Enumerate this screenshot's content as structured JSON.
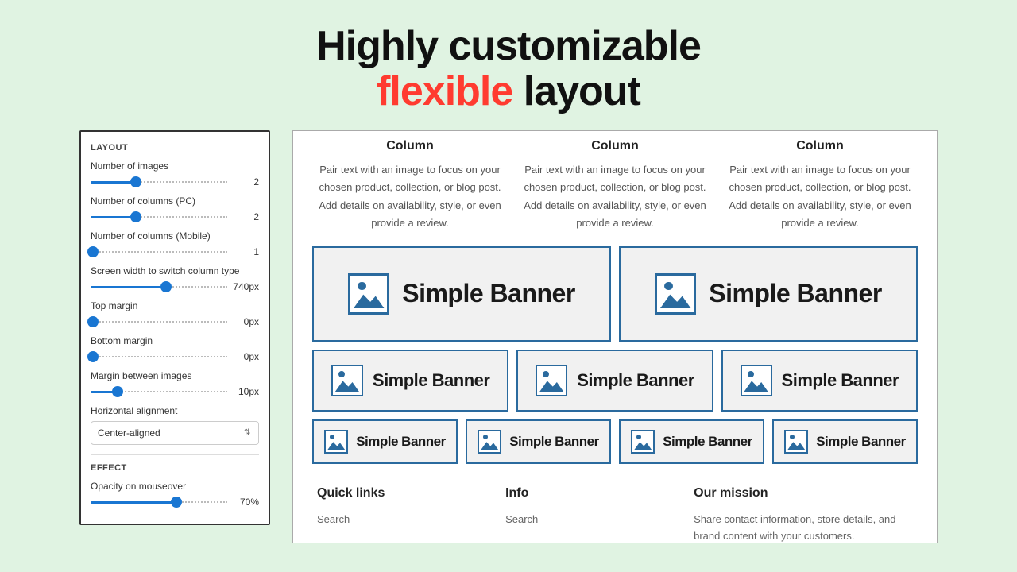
{
  "hero": {
    "line1": "Highly customizable",
    "accent": "flexible",
    "line2_rest": " layout"
  },
  "sidebar": {
    "section_layout": "LAYOUT",
    "section_effect": "EFFECT",
    "controls": {
      "num_images": {
        "label": "Number of images",
        "value": "2",
        "pct": 33
      },
      "num_cols_pc": {
        "label": "Number of columns (PC)",
        "value": "2",
        "pct": 33
      },
      "num_cols_mobile": {
        "label": "Number of columns (Mobile)",
        "value": "1",
        "pct": 2
      },
      "switch_width": {
        "label": "Screen width to switch column type",
        "value": "740px",
        "pct": 55
      },
      "top_margin": {
        "label": "Top margin",
        "value": "0px",
        "pct": 2
      },
      "bottom_margin": {
        "label": "Bottom margin",
        "value": "0px",
        "pct": 2
      },
      "img_margin": {
        "label": "Margin between images",
        "value": "10px",
        "pct": 20
      },
      "h_align": {
        "label": "Horizontal alignment",
        "value": "Center-aligned"
      },
      "opacity": {
        "label": "Opacity on mouseover",
        "value": "70%",
        "pct": 63
      }
    }
  },
  "preview": {
    "column_heading": "Column",
    "column_body": "Pair text with an image to focus on your chosen product, collection, or blog post. Add details on availability, style, or even provide a review.",
    "banner_text": "Simple Banner",
    "footer": {
      "quick_links": {
        "title": "Quick links",
        "item": "Search"
      },
      "info": {
        "title": "Info",
        "item": "Search"
      },
      "mission": {
        "title": "Our mission",
        "body": "Share contact information, store details, and brand content with your customers."
      }
    }
  }
}
